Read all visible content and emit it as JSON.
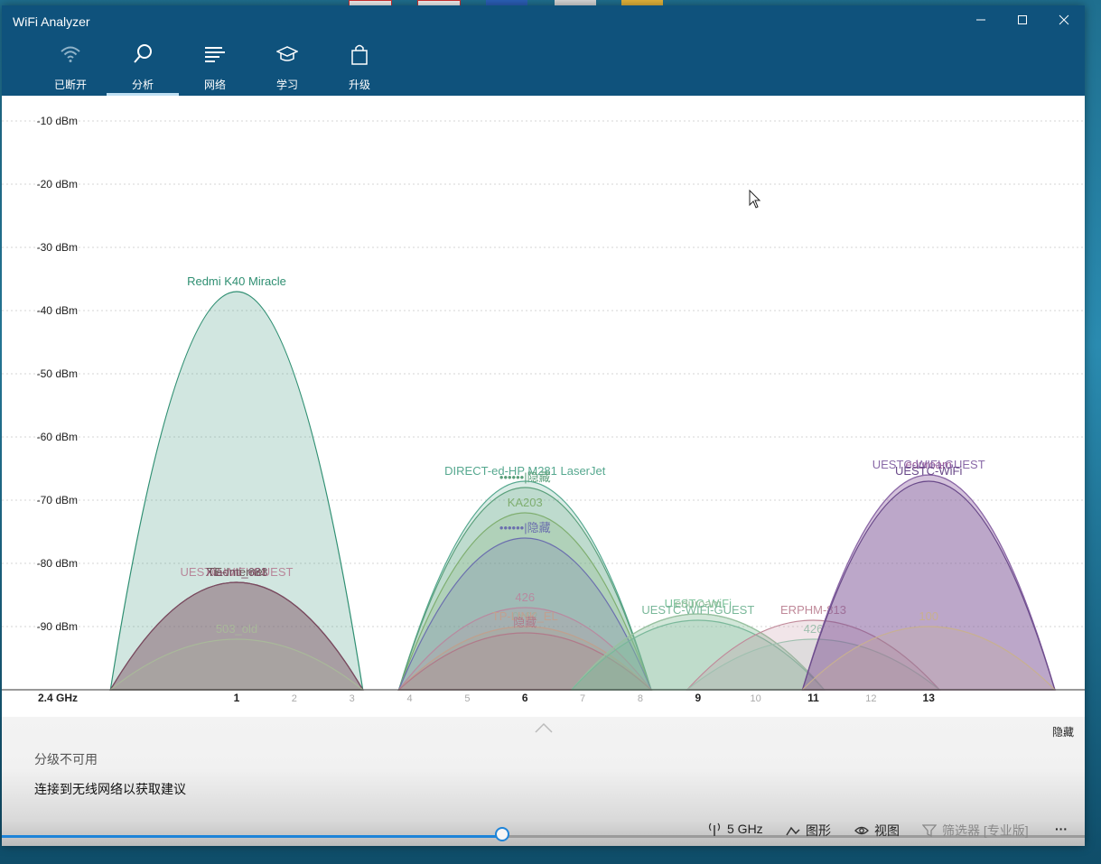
{
  "window": {
    "title": "WiFi Analyzer"
  },
  "nav": {
    "items": [
      {
        "label": "已断开",
        "icon": "wifi-icon"
      },
      {
        "label": "分析",
        "icon": "search-icon"
      },
      {
        "label": "网络",
        "icon": "list-icon"
      },
      {
        "label": "学习",
        "icon": "graduation-cap-icon"
      },
      {
        "label": "升级",
        "icon": "shopping-bag-icon"
      }
    ],
    "active": "分析"
  },
  "chart_data": {
    "type": "area",
    "band_label": "2.4 GHz",
    "ylabel_unit": "dBm",
    "y_ticks": [
      "-10 dBm",
      "-20 dBm",
      "-30 dBm",
      "-40 dBm",
      "-50 dBm",
      "-60 dBm",
      "-70 dBm",
      "-80 dBm",
      "-90 dBm"
    ],
    "ylim": [
      -100,
      -5
    ],
    "x_ticks": [
      "1",
      "2",
      "3",
      "4",
      "5",
      "6",
      "7",
      "8",
      "9",
      "10",
      "11",
      "12",
      "13"
    ],
    "x_ticks_emphasized": [
      "1",
      "6",
      "9",
      "11",
      "13"
    ],
    "grid": true,
    "series": [
      {
        "name": "Redmi K40 Miracle",
        "channel": 1,
        "dbm": -37,
        "color": "#2f8f72"
      },
      {
        "name": "UESTC-WIFI-GUEST",
        "channel": 1,
        "dbm": -83,
        "color": "#b8879a"
      },
      {
        "name": "TE-Internet",
        "channel": 1,
        "dbm": -83,
        "color": "#6b5a5a"
      },
      {
        "name": "Xiaomi_683",
        "channel": 1,
        "dbm": -83,
        "color": "#7a4a60"
      },
      {
        "name": "503_old",
        "channel": 1,
        "dbm": -92,
        "color": "#a9b89a"
      },
      {
        "name": "DIRECT-ed-HP M281 LaserJet",
        "channel": 6,
        "dbm": -67,
        "color": "#56a88f"
      },
      {
        "name": "••••••|隐藏",
        "channel": 6,
        "dbm": -68,
        "color": "#5a9f7a"
      },
      {
        "name": "KA203",
        "channel": 6,
        "dbm": -72,
        "color": "#7fae70"
      },
      {
        "name": "••••••|隐藏",
        "channel": 6,
        "dbm": -76,
        "color": "#6b6fae"
      },
      {
        "name": "426",
        "channel": 6,
        "dbm": -87,
        "color": "#b88aa0"
      },
      {
        "name": "0x62",
        "channel": 6,
        "dbm": -90,
        "color": "#9ab0a0"
      },
      {
        "name": "TP-LINK_EL",
        "channel": 6,
        "dbm": -90,
        "color": "#c0a090"
      },
      {
        "name": "隐藏",
        "channel": 6,
        "dbm": -91,
        "color": "#b07a8a"
      },
      {
        "name": "UESTC-WiFi",
        "channel": 9,
        "dbm": -88,
        "color": "#7cc39b"
      },
      {
        "name": "eduroam",
        "channel": 9,
        "dbm": -88,
        "color": "#9ac0a0"
      },
      {
        "name": "UESTC-WIFI-GUEST",
        "channel": 9,
        "dbm": -89,
        "color": "#7ab89a"
      },
      {
        "name": "ERPHM-813",
        "channel": 11,
        "dbm": -89,
        "color": "#c08a9a"
      },
      {
        "name": "426",
        "channel": 11,
        "dbm": -92,
        "color": "#a0c0b0"
      },
      {
        "name": "eduroam",
        "channel": 13,
        "dbm": -66,
        "color": "#9a5a9a"
      },
      {
        "name": "UESTC-WIFI-GUEST",
        "channel": 13,
        "dbm": -66,
        "color": "#8a6aa8"
      },
      {
        "name": "UESTC-WiFi",
        "channel": 13,
        "dbm": -67,
        "color": "#6a4a8a"
      },
      {
        "name": "100",
        "channel": 13,
        "dbm": -90,
        "color": "#c8b090"
      }
    ]
  },
  "bottom": {
    "hide_label": "隐藏",
    "rating_text": "分级不可用",
    "advice_text": "连接到无线网络以获取建议",
    "slider_fraction": 0.465,
    "commands": {
      "band": "5 GHz",
      "graph": "图形",
      "view": "视图",
      "filter": "筛选器 [专业版]",
      "more": "···"
    }
  },
  "colors": {
    "titlebar": "#0f527c",
    "accent": "#1e84d8"
  }
}
